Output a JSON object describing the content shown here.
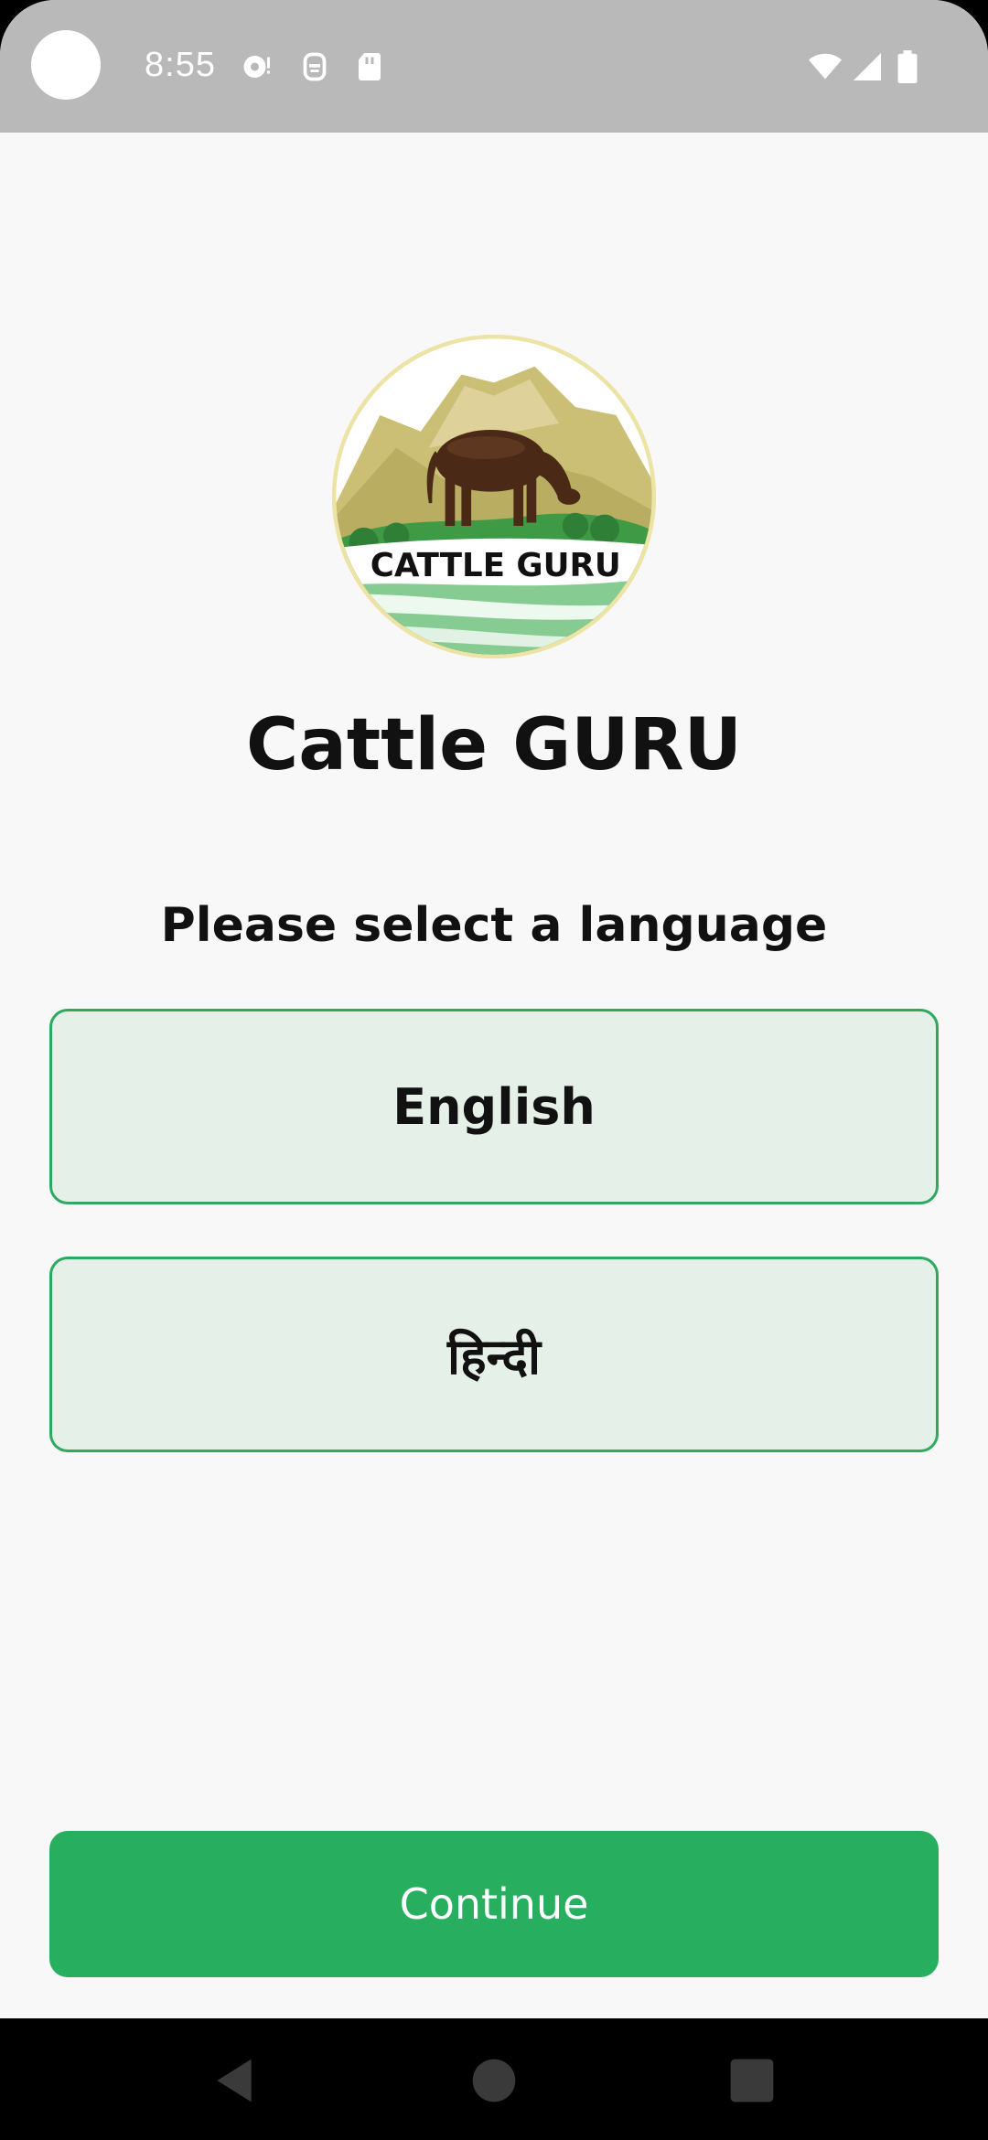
{
  "status_bar": {
    "time": "8:55",
    "icons": [
      "camera-dot",
      "cloud-sync-icon",
      "robot-icon",
      "sd-card-icon",
      "wifi-icon",
      "signal-icon",
      "battery-icon"
    ]
  },
  "logo": {
    "alt": "CATTLE GURU",
    "text": "CATTLE GURU"
  },
  "header": {
    "title": "Cattle GURU"
  },
  "language_select": {
    "prompt": "Please select a language",
    "options": [
      {
        "label": "English"
      },
      {
        "label": "हिन्दी"
      }
    ]
  },
  "actions": {
    "continue_label": "Continue"
  },
  "nav_bar": {
    "buttons": [
      "back-icon",
      "home-icon",
      "recents-icon"
    ]
  },
  "colors": {
    "accent": "#27af5f",
    "option_bg": "#e5f0e8",
    "option_border": "#2eaa5f",
    "status_bar_bg": "#b9b9b9",
    "screen_bg": "#f8f8f8"
  }
}
